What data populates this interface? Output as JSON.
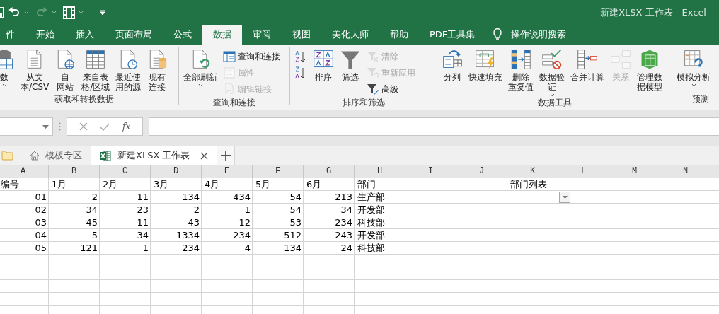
{
  "title_bar": {
    "title": "新建XLSX 工作表  -  Excel"
  },
  "menu_tabs": [
    {
      "label": "件",
      "selected": false
    },
    {
      "label": "开始",
      "selected": false
    },
    {
      "label": "插入",
      "selected": false
    },
    {
      "label": "页面布局",
      "selected": false
    },
    {
      "label": "公式",
      "selected": false
    },
    {
      "label": "数据",
      "selected": true
    },
    {
      "label": "审阅",
      "selected": false
    },
    {
      "label": "视图",
      "selected": false
    },
    {
      "label": "美化大师",
      "selected": false
    },
    {
      "label": "帮助",
      "selected": false
    },
    {
      "label": "PDF工具集",
      "selected": false
    }
  ],
  "tell_me": {
    "label": "操作说明搜索"
  },
  "ribbon": {
    "groups": [
      {
        "label": "获取和转换数据",
        "items": [
          {
            "kind": "large",
            "label": "数",
            "caret": true,
            "disabled": false
          },
          {
            "kind": "large",
            "label": "从文本/CSV",
            "caret": false,
            "disabled": false
          },
          {
            "kind": "large",
            "label": "自网站",
            "caret": false,
            "disabled": false
          },
          {
            "kind": "large",
            "label": "来自表格/区域",
            "caret": false,
            "disabled": false
          },
          {
            "kind": "large",
            "label": "最近使用的源",
            "caret": false,
            "disabled": false
          },
          {
            "kind": "large",
            "label": "现有连接",
            "caret": false,
            "disabled": false
          }
        ]
      },
      {
        "label": "查询和连接",
        "items": [
          {
            "kind": "large",
            "label": "全部刷新",
            "caret": true,
            "disabled": false
          },
          {
            "kind": "small",
            "label": "查询和连接",
            "caret": false,
            "disabled": false
          },
          {
            "kind": "small",
            "label": "属性",
            "caret": false,
            "disabled": true
          },
          {
            "kind": "small",
            "label": "编辑链接",
            "caret": false,
            "disabled": true
          }
        ]
      },
      {
        "label": "排序和筛选",
        "items": [
          {
            "kind": "small-icon",
            "caret": false,
            "disabled": false
          },
          {
            "kind": "small-icon",
            "caret": false,
            "disabled": false
          },
          {
            "kind": "large",
            "label": "排序",
            "caret": false,
            "disabled": false
          },
          {
            "kind": "large",
            "label": "筛选",
            "caret": false,
            "disabled": false
          },
          {
            "kind": "small",
            "label": "清除",
            "caret": false,
            "disabled": true
          },
          {
            "kind": "small",
            "label": "重新应用",
            "caret": false,
            "disabled": true
          },
          {
            "kind": "small",
            "label": "高级",
            "caret": false,
            "disabled": false
          }
        ]
      },
      {
        "label": "数据工具",
        "items": [
          {
            "kind": "large",
            "label": "分列",
            "caret": false,
            "disabled": false
          },
          {
            "kind": "large",
            "label": "快速填充",
            "caret": false,
            "disabled": false
          },
          {
            "kind": "large",
            "label": "删除重复值",
            "caret": false,
            "disabled": false
          },
          {
            "kind": "large",
            "label": "数据验证",
            "caret": true,
            "disabled": false
          },
          {
            "kind": "large",
            "label": "合并计算",
            "caret": false,
            "disabled": false
          },
          {
            "kind": "large",
            "label": "关系",
            "caret": false,
            "disabled": true
          },
          {
            "kind": "large",
            "label": "管理数据模型",
            "caret": false,
            "disabled": false
          }
        ]
      },
      {
        "label": "预测",
        "items": [
          {
            "kind": "large",
            "label": "模拟分析",
            "caret": true,
            "disabled": false
          }
        ]
      }
    ]
  },
  "formula_bar": {
    "fx": "fx"
  },
  "sheet_tabs": [
    {
      "kind": "home",
      "label": "模板专区",
      "selected": false,
      "closable": false
    },
    {
      "kind": "workbook",
      "label": "新建XLSX 工作表",
      "selected": true,
      "closable": true
    }
  ],
  "grid": {
    "columns": [
      "A",
      "B",
      "C",
      "D",
      "E",
      "F",
      "G",
      "H",
      "I",
      "J",
      "K",
      "L",
      "M",
      "N"
    ],
    "list_title": "部门列表",
    "rows": [
      {
        "kind": "header",
        "cells": [
          "编号",
          "1月",
          "2月",
          "3月",
          "4月",
          "5月",
          "6月",
          "部门"
        ]
      },
      {
        "kind": "data",
        "cells": [
          "01",
          "2",
          "11",
          "134",
          "434",
          "54",
          "213",
          "生产部"
        ]
      },
      {
        "kind": "data",
        "cells": [
          "02",
          "34",
          "23",
          "2",
          "1",
          "54",
          "34",
          "开发部"
        ]
      },
      {
        "kind": "data",
        "cells": [
          "03",
          "45",
          "11",
          "43",
          "12",
          "53",
          "234",
          "科技部"
        ]
      },
      {
        "kind": "data",
        "cells": [
          "04",
          "5",
          "34",
          "1334",
          "234",
          "512",
          "243",
          "开发部"
        ]
      },
      {
        "kind": "data",
        "cells": [
          "05",
          "121",
          "1",
          "234",
          "4",
          "134",
          "24",
          "科技部"
        ]
      }
    ]
  }
}
